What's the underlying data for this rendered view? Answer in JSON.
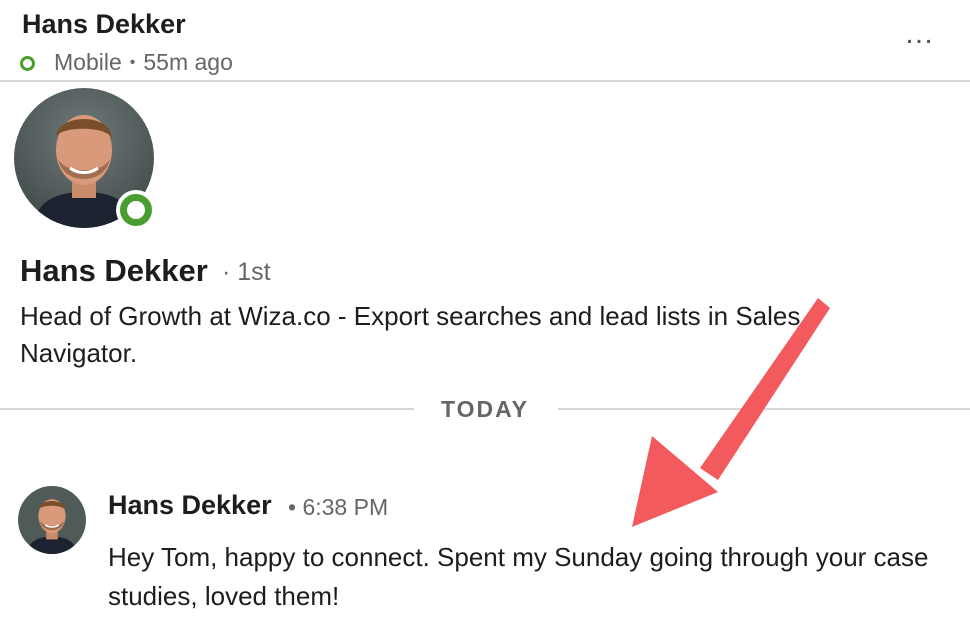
{
  "header": {
    "name": "Hans Dekker",
    "presence_device": "Mobile",
    "presence_time": "55m ago",
    "more_glyph": "…"
  },
  "profile": {
    "name": "Hans Dekker",
    "degree": "· 1st",
    "headline": "Head of Growth at Wiza.co - Export searches and lead lists in Sales Navigator.",
    "status": "online"
  },
  "divider": {
    "label": "TODAY"
  },
  "message": {
    "sender": "Hans Dekker",
    "time": "6:38 PM",
    "text": "Hey Tom, happy to connect. Spent my Sunday going through your case studies, loved them!"
  },
  "colors": {
    "online_green": "#4a9e2f",
    "annotation_arrow": "#f25a5e"
  }
}
